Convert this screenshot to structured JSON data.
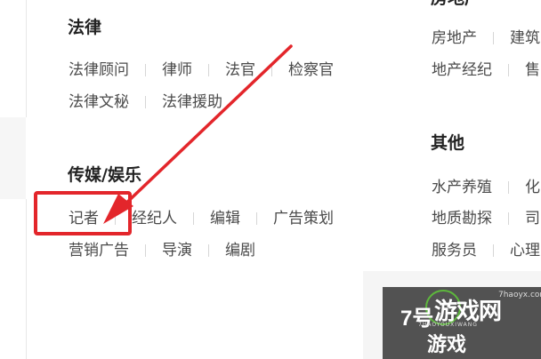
{
  "sections": {
    "law": {
      "title": "法律",
      "row1": [
        "法律顾问",
        "律师",
        "法官",
        "检察官"
      ],
      "row2": [
        "法律文秘",
        "法律援助"
      ]
    },
    "media": {
      "title": "传媒/娱乐",
      "row1": [
        "记者",
        "经纪人",
        "编辑",
        "广告策划"
      ],
      "row2": [
        "营销广告",
        "导演",
        "编剧"
      ]
    },
    "realestate": {
      "title_partial": "房地产",
      "row1": [
        "房地产",
        "建筑"
      ],
      "row2": [
        "地产经纪",
        "售"
      ]
    },
    "other": {
      "title": "其他",
      "row1": [
        "水产养殖",
        "化"
      ],
      "row2": [
        "地质勘探",
        "司"
      ],
      "row3": [
        "服务员",
        "心理"
      ]
    }
  },
  "watermark": {
    "number": "7号",
    "brand": "游戏网",
    "sub": "游戏",
    "site": "7haoyx.com",
    "pinyin": "7HAOYOUXIWANG"
  },
  "colors": {
    "annotation_red": "#e3262b",
    "title_text": "#222222",
    "link_text": "#4a4a4a"
  }
}
